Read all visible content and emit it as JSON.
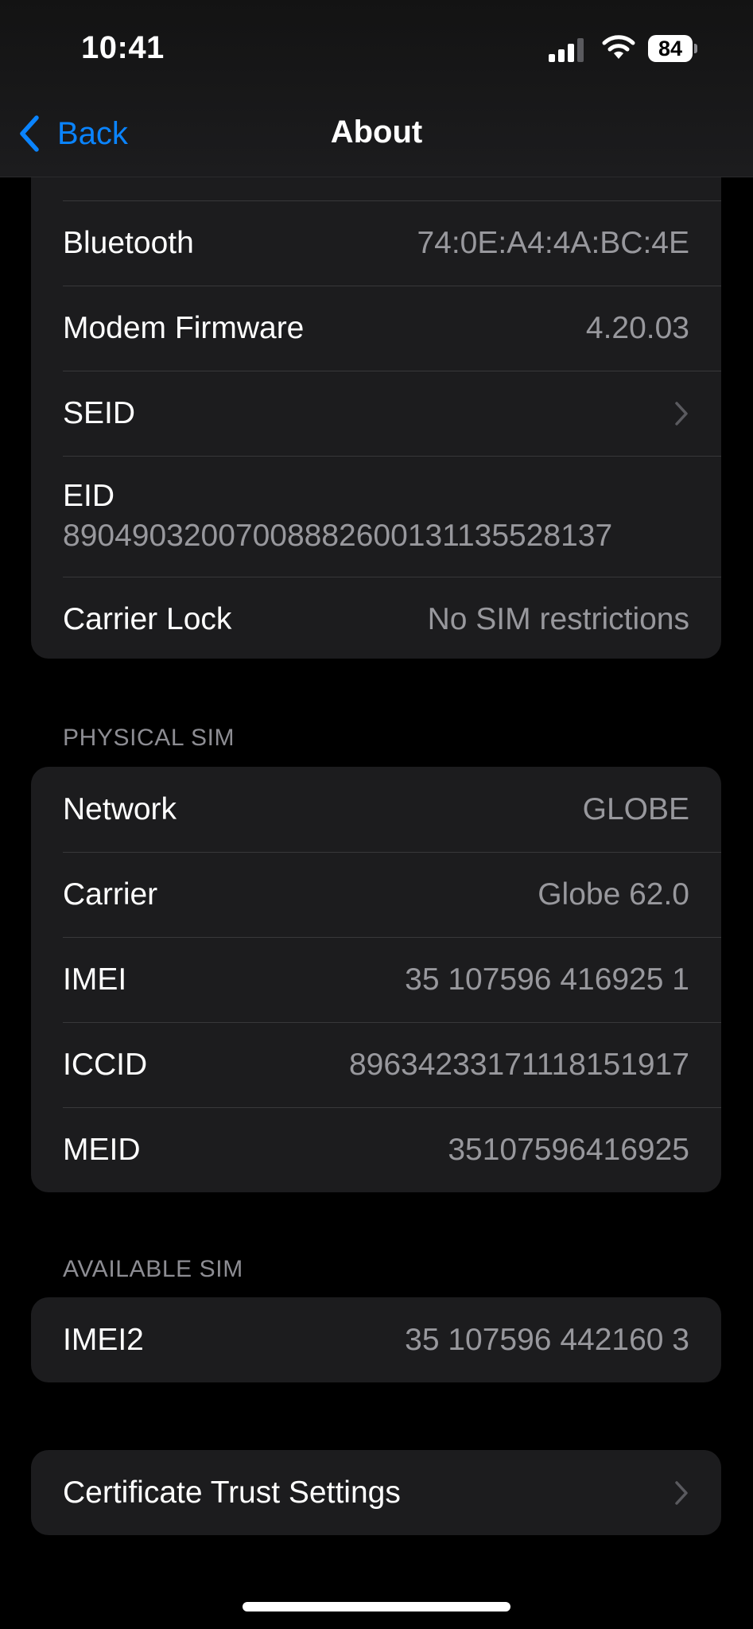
{
  "status_bar": {
    "time": "10:41",
    "battery": "84"
  },
  "nav": {
    "back_label": "Back",
    "title": "About"
  },
  "group_device": {
    "rows": [
      {
        "label": "Bluetooth",
        "value": "74:0E:A4:4A:BC:4E"
      },
      {
        "label": "Modem Firmware",
        "value": "4.20.03"
      },
      {
        "label": "SEID",
        "value": ""
      },
      {
        "label": "EID",
        "value": "89049032007008882600131135528137"
      },
      {
        "label": "Carrier Lock",
        "value": "No SIM restrictions"
      }
    ]
  },
  "physical_sim": {
    "header": "PHYSICAL SIM",
    "rows": [
      {
        "label": "Network",
        "value": "GLOBE"
      },
      {
        "label": "Carrier",
        "value": "Globe 62.0"
      },
      {
        "label": "IMEI",
        "value": "35 107596 416925 1"
      },
      {
        "label": "ICCID",
        "value": "8963423317111815191​7"
      },
      {
        "label": "MEID",
        "value": "35107596416925"
      }
    ]
  },
  "available_sim": {
    "header": "AVAILABLE SIM",
    "rows": [
      {
        "label": "IMEI2",
        "value": "35 107596 442160 3"
      }
    ]
  },
  "certificate": {
    "label": "Certificate Trust Settings"
  },
  "colors": {
    "accent": "#0a84ff",
    "background": "#000000",
    "cell": "#1c1c1e",
    "secondary_text": "#98989d",
    "separator": "#38383a"
  },
  "icons": [
    "chevron-left-icon",
    "chevron-right-icon",
    "cellular-signal-icon",
    "wifi-icon",
    "battery-icon"
  ]
}
